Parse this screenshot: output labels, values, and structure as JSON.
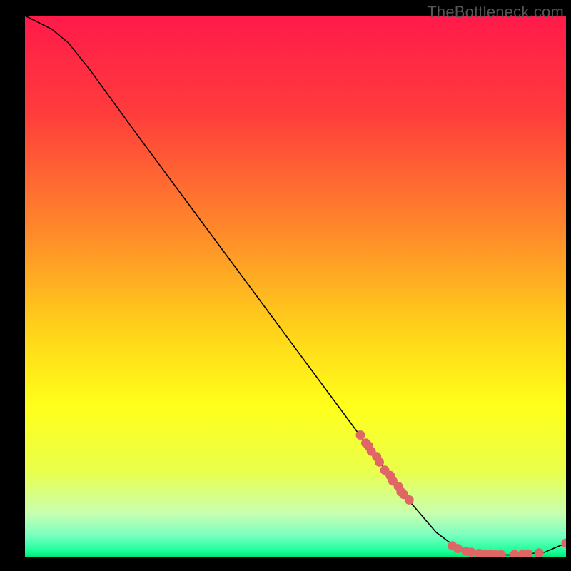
{
  "watermark": "TheBottleneck.com",
  "chart_data": {
    "type": "line",
    "title": "",
    "xlabel": "",
    "ylabel": "",
    "xlim": [
      0,
      100
    ],
    "ylim": [
      0,
      100
    ],
    "gradient_stops": [
      {
        "offset": 0,
        "color": "#ff1a4a"
      },
      {
        "offset": 18,
        "color": "#ff3c3c"
      },
      {
        "offset": 40,
        "color": "#ff8a2a"
      },
      {
        "offset": 58,
        "color": "#ffd21a"
      },
      {
        "offset": 72,
        "color": "#ffff1a"
      },
      {
        "offset": 84,
        "color": "#eaff4a"
      },
      {
        "offset": 92,
        "color": "#c8ffb0"
      },
      {
        "offset": 96,
        "color": "#7affc0"
      },
      {
        "offset": 99,
        "color": "#1aff9a"
      },
      {
        "offset": 100,
        "color": "#00e878"
      }
    ],
    "curve": [
      {
        "x": 0,
        "y": 100
      },
      {
        "x": 2,
        "y": 99
      },
      {
        "x": 5,
        "y": 97.5
      },
      {
        "x": 8,
        "y": 95
      },
      {
        "x": 12,
        "y": 90
      },
      {
        "x": 20,
        "y": 79
      },
      {
        "x": 30,
        "y": 65.5
      },
      {
        "x": 40,
        "y": 52
      },
      {
        "x": 50,
        "y": 38.5
      },
      {
        "x": 60,
        "y": 25
      },
      {
        "x": 70,
        "y": 11.5
      },
      {
        "x": 76,
        "y": 4.5
      },
      {
        "x": 80,
        "y": 1.5
      },
      {
        "x": 84,
        "y": 0.5
      },
      {
        "x": 90,
        "y": 0.3
      },
      {
        "x": 96,
        "y": 0.8
      },
      {
        "x": 100,
        "y": 2.5
      }
    ],
    "scatter_points": [
      {
        "x": 62,
        "y": 22.5
      },
      {
        "x": 63,
        "y": 21
      },
      {
        "x": 63.5,
        "y": 20.5
      },
      {
        "x": 64,
        "y": 19.5
      },
      {
        "x": 65,
        "y": 18.5
      },
      {
        "x": 65.5,
        "y": 17.5
      },
      {
        "x": 66.5,
        "y": 16
      },
      {
        "x": 67.5,
        "y": 15
      },
      {
        "x": 68,
        "y": 14
      },
      {
        "x": 69,
        "y": 13
      },
      {
        "x": 69.5,
        "y": 12
      },
      {
        "x": 70,
        "y": 11.5
      },
      {
        "x": 71,
        "y": 10.5
      },
      {
        "x": 79,
        "y": 2
      },
      {
        "x": 80,
        "y": 1.5
      },
      {
        "x": 81.5,
        "y": 1
      },
      {
        "x": 82.5,
        "y": 0.8
      },
      {
        "x": 84,
        "y": 0.6
      },
      {
        "x": 85,
        "y": 0.5
      },
      {
        "x": 86,
        "y": 0.5
      },
      {
        "x": 87,
        "y": 0.4
      },
      {
        "x": 88,
        "y": 0.4
      },
      {
        "x": 90.5,
        "y": 0.4
      },
      {
        "x": 92,
        "y": 0.5
      },
      {
        "x": 93,
        "y": 0.5
      },
      {
        "x": 95,
        "y": 0.7
      },
      {
        "x": 100,
        "y": 2.5
      }
    ],
    "marker_color": "#e06666",
    "curve_color": "#000000"
  }
}
